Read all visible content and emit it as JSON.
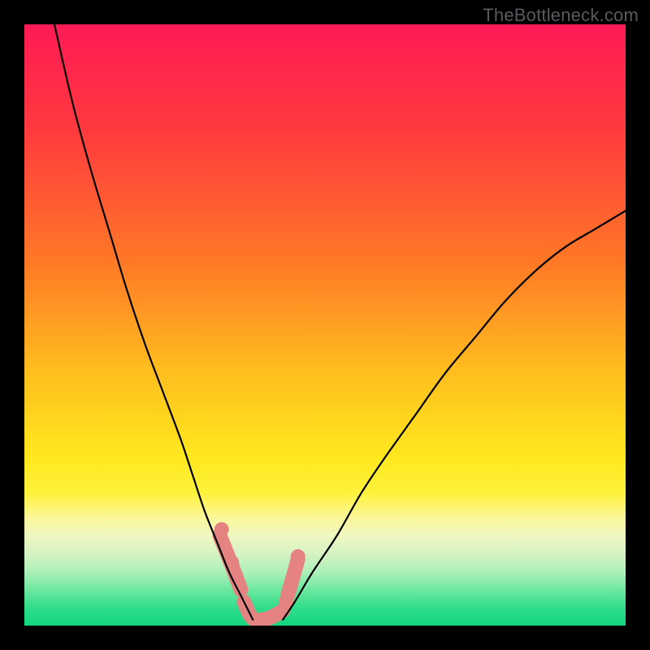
{
  "watermark": "TheBottleneck.com",
  "chart_data": {
    "type": "line",
    "title": "",
    "xlabel": "",
    "ylabel": "",
    "xlim": [
      0,
      100
    ],
    "ylim": [
      0,
      100
    ],
    "grid": false,
    "legend": false,
    "gradient_bands": [
      {
        "stop": 0.0,
        "color": "#ff1a55"
      },
      {
        "stop": 0.18,
        "color": "#ff3b3e"
      },
      {
        "stop": 0.4,
        "color": "#ff7a26"
      },
      {
        "stop": 0.58,
        "color": "#ffbf1e"
      },
      {
        "stop": 0.72,
        "color": "#ffe81e"
      },
      {
        "stop": 0.78,
        "color": "#fff23c"
      },
      {
        "stop": 0.82,
        "color": "#fbf79a"
      },
      {
        "stop": 0.85,
        "color": "#f0f7c0"
      },
      {
        "stop": 0.88,
        "color": "#d6f3c4"
      },
      {
        "stop": 0.91,
        "color": "#aef0b9"
      },
      {
        "stop": 0.94,
        "color": "#6ee8a1"
      },
      {
        "stop": 0.97,
        "color": "#2fdd8b"
      },
      {
        "stop": 1.0,
        "color": "#13d67e"
      }
    ],
    "series": [
      {
        "name": "left-curve",
        "color": "#000000",
        "width": 2.2,
        "x": [
          5,
          8,
          11,
          14,
          17,
          20,
          23,
          26,
          28,
          30,
          32,
          34,
          36,
          37,
          38
        ],
        "y": [
          100,
          87,
          76,
          66,
          56,
          47,
          39,
          31,
          25,
          19,
          14,
          9,
          5,
          3,
          1
        ]
      },
      {
        "name": "right-curve",
        "color": "#000000",
        "width": 2.2,
        "x": [
          43,
          45,
          48,
          52,
          56,
          60,
          65,
          70,
          75,
          80,
          85,
          90,
          95,
          100
        ],
        "y": [
          1,
          4,
          9,
          15,
          22,
          28,
          35,
          42,
          48,
          54,
          59,
          63,
          66,
          69
        ]
      },
      {
        "name": "valley-marker",
        "type": "marker-path",
        "color": "#e58383",
        "stroke_width": 18,
        "segments": [
          {
            "x": [
              32.5,
              34.5,
              36.0
            ],
            "y": [
              15,
              10,
              6
            ]
          },
          {
            "x": [
              36.5,
              38.0,
              40.5,
              43.0
            ],
            "y": [
              4,
              1.2,
              1.2,
              2.5
            ]
          },
          {
            "x": [
              43.8,
              45.5
            ],
            "y": [
              5,
              11
            ]
          }
        ],
        "dots": [
          {
            "x": 32.8,
            "y": 16,
            "r": 9
          },
          {
            "x": 34.5,
            "y": 10.5,
            "r": 9
          },
          {
            "x": 36.0,
            "y": 6.0,
            "r": 9
          },
          {
            "x": 43.5,
            "y": 4.0,
            "r": 9
          },
          {
            "x": 45.5,
            "y": 11.5,
            "r": 9
          }
        ]
      }
    ]
  }
}
